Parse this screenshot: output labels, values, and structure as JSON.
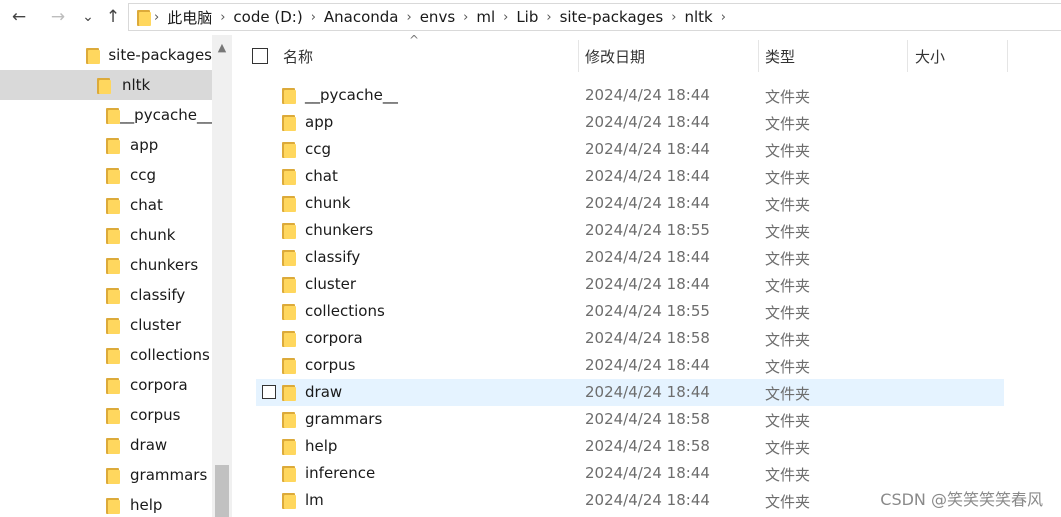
{
  "nav_buttons": {
    "back": "←",
    "forward": "→",
    "recent": "⌄",
    "up": "↑"
  },
  "address": {
    "separator": "›",
    "crumbs": [
      "此电脑",
      "code (D:)",
      "Anaconda",
      "envs",
      "ml",
      "Lib",
      "site-packages",
      "nltk"
    ]
  },
  "nav_pane": {
    "items": [
      {
        "label": "site-packages",
        "level": 0,
        "selected": false
      },
      {
        "label": "nltk",
        "level": 1,
        "selected": true
      },
      {
        "label": "__pycache__",
        "level": 2,
        "selected": false
      },
      {
        "label": "app",
        "level": 2,
        "selected": false
      },
      {
        "label": "ccg",
        "level": 2,
        "selected": false
      },
      {
        "label": "chat",
        "level": 2,
        "selected": false
      },
      {
        "label": "chunk",
        "level": 2,
        "selected": false
      },
      {
        "label": "chunkers",
        "level": 2,
        "selected": false
      },
      {
        "label": "classify",
        "level": 2,
        "selected": false
      },
      {
        "label": "cluster",
        "level": 2,
        "selected": false
      },
      {
        "label": "collections",
        "level": 2,
        "selected": false
      },
      {
        "label": "corpora",
        "level": 2,
        "selected": false
      },
      {
        "label": "corpus",
        "level": 2,
        "selected": false
      },
      {
        "label": "draw",
        "level": 2,
        "selected": false
      },
      {
        "label": "grammars",
        "level": 2,
        "selected": false
      },
      {
        "label": "help",
        "level": 2,
        "selected": false
      }
    ],
    "scroll_up": "▲"
  },
  "columns": {
    "name": "名称",
    "modified": "修改日期",
    "type": "类型",
    "size": "大小",
    "sort_indicator": "^"
  },
  "files": [
    {
      "name": "__pycache__",
      "modified": "2024/4/24 18:44",
      "type": "文件夹",
      "hover": false
    },
    {
      "name": "app",
      "modified": "2024/4/24 18:44",
      "type": "文件夹",
      "hover": false
    },
    {
      "name": "ccg",
      "modified": "2024/4/24 18:44",
      "type": "文件夹",
      "hover": false
    },
    {
      "name": "chat",
      "modified": "2024/4/24 18:44",
      "type": "文件夹",
      "hover": false
    },
    {
      "name": "chunk",
      "modified": "2024/4/24 18:44",
      "type": "文件夹",
      "hover": false
    },
    {
      "name": "chunkers",
      "modified": "2024/4/24 18:55",
      "type": "文件夹",
      "hover": false
    },
    {
      "name": "classify",
      "modified": "2024/4/24 18:44",
      "type": "文件夹",
      "hover": false
    },
    {
      "name": "cluster",
      "modified": "2024/4/24 18:44",
      "type": "文件夹",
      "hover": false
    },
    {
      "name": "collections",
      "modified": "2024/4/24 18:55",
      "type": "文件夹",
      "hover": false
    },
    {
      "name": "corpora",
      "modified": "2024/4/24 18:58",
      "type": "文件夹",
      "hover": false
    },
    {
      "name": "corpus",
      "modified": "2024/4/24 18:44",
      "type": "文件夹",
      "hover": false
    },
    {
      "name": "draw",
      "modified": "2024/4/24 18:44",
      "type": "文件夹",
      "hover": true
    },
    {
      "name": "grammars",
      "modified": "2024/4/24 18:58",
      "type": "文件夹",
      "hover": false
    },
    {
      "name": "help",
      "modified": "2024/4/24 18:58",
      "type": "文件夹",
      "hover": false
    },
    {
      "name": "inference",
      "modified": "2024/4/24 18:44",
      "type": "文件夹",
      "hover": false
    },
    {
      "name": "lm",
      "modified": "2024/4/24 18:44",
      "type": "文件夹",
      "hover": false
    }
  ],
  "watermark": "CSDN @笑笑笑笑春风",
  "colors": {
    "selected_bg": "#d9d9d9",
    "hover_bg": "#e5f3ff",
    "folder_front": "#ffd75e",
    "folder_back": "#dcaa3a"
  }
}
